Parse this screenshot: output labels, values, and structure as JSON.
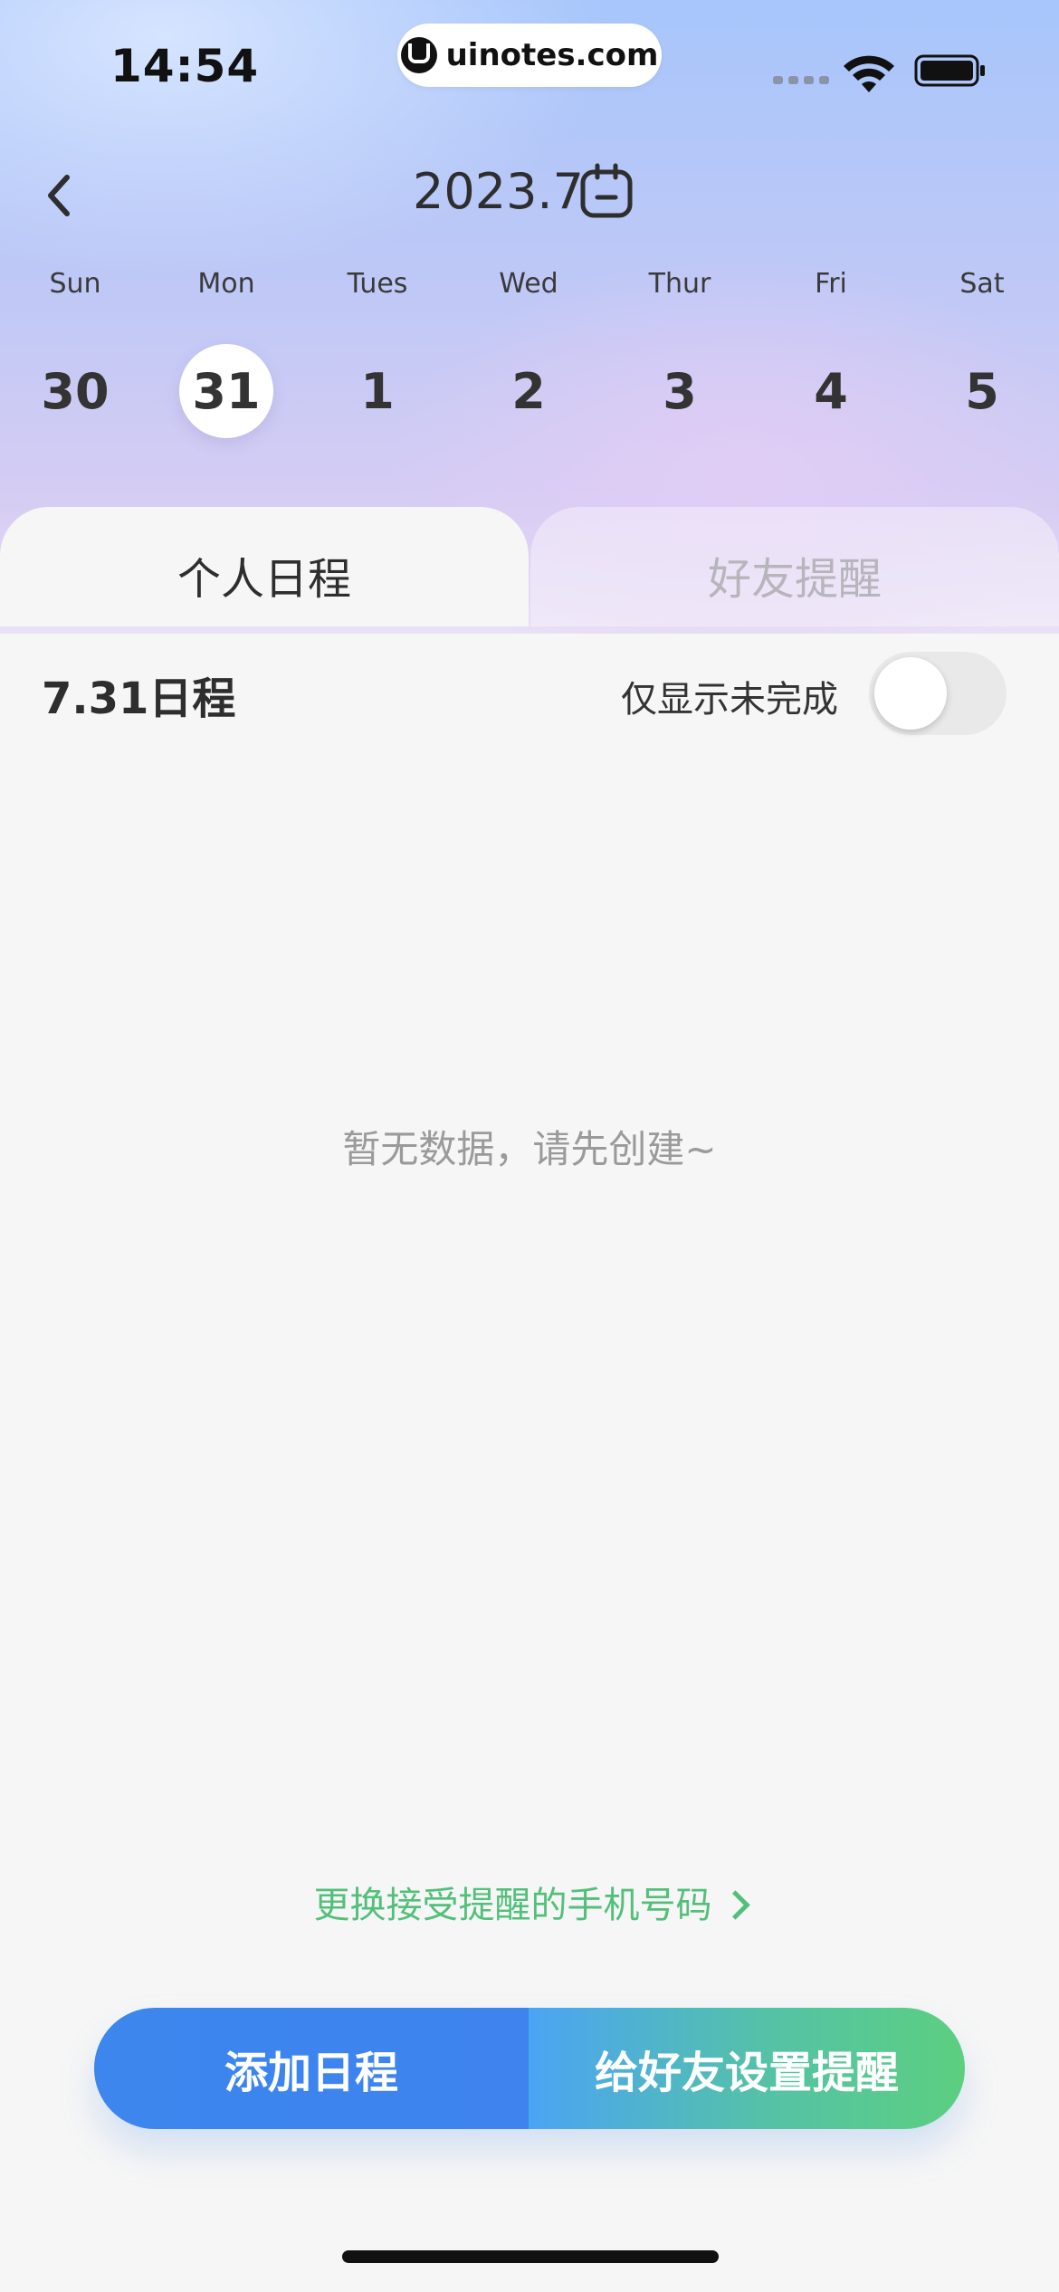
{
  "status_bar": {
    "time": "14:54",
    "url": "uinotes.com"
  },
  "header": {
    "month": "2023.7"
  },
  "calendar": {
    "weekdays": [
      "Sun",
      "Mon",
      "Tues",
      "Wed",
      "Thur",
      "Fri",
      "Sat"
    ],
    "dates": [
      "30",
      "31",
      "1",
      "2",
      "3",
      "4",
      "5"
    ],
    "selected": "31"
  },
  "tabs": [
    {
      "label": "个人日程",
      "active": true
    },
    {
      "label": "好友提醒",
      "active": false
    }
  ],
  "schedule": {
    "title": "7.31日程",
    "filter_label": "仅显示未完成",
    "filter_on": false,
    "empty_text": "暂无数据，请先创建~"
  },
  "footer": {
    "phone_link": "更换接受提醒的手机号码",
    "add_button": "添加日程",
    "friend_button": "给好友设置提醒"
  },
  "colors": {
    "accent_blue": "#3c86ee",
    "accent_green": "#52c07a"
  }
}
